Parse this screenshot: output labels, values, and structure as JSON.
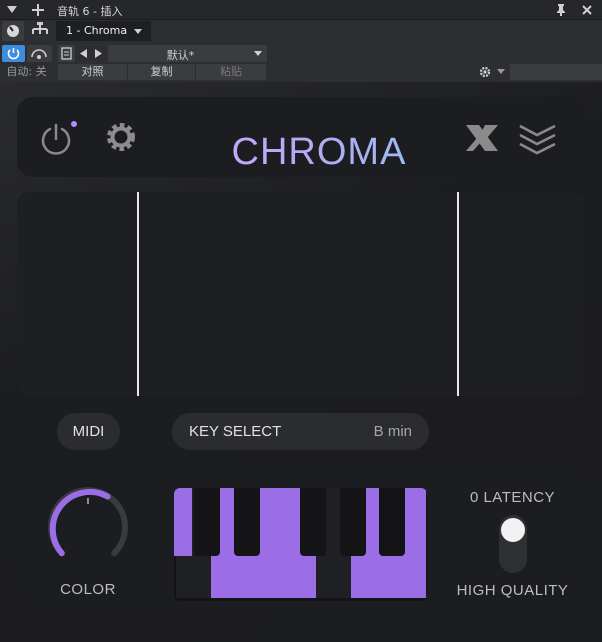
{
  "host": {
    "title": "音轨 6 - 插入",
    "instance": "1 - Chroma",
    "preset": "默认*",
    "auto": "自动: 关",
    "compare": "对照",
    "copy": "复制",
    "paste": "粘贴"
  },
  "plugin": {
    "logo": "CHROMA",
    "midi_label": "MIDI",
    "key_select_label": "KEY SELECT",
    "key_value": "B min",
    "color_label": "COLOR",
    "latency_label": "0 LATENCY",
    "quality_label": "HIGH QUALITY"
  },
  "colors": {
    "accent": "#9b6ee8",
    "panel": "#1c1d20",
    "host_bar": "#2c2e31"
  },
  "keyboard": {
    "white_keys_active": [
      false,
      true,
      true,
      true,
      false,
      true,
      true,
      true
    ],
    "black_keys_active": [
      true,
      false,
      false,
      true,
      false,
      false
    ]
  }
}
